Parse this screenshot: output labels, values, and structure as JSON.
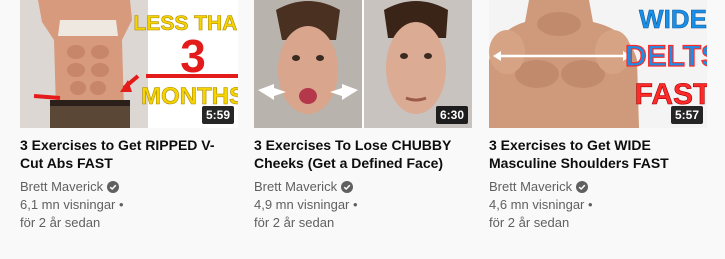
{
  "videos": [
    {
      "thumbnail_text": [
        "LESS THAN",
        "3",
        "MONTHS"
      ],
      "duration": "5:59",
      "title_lines": [
        "3 Exercises to Get RIPPED V-",
        "Cut Abs FAST"
      ],
      "channel": "Brett Maverick",
      "views": "6,1 mn visningar •",
      "age": "för 2 år sedan",
      "verified_icon": "verified-check-icon"
    },
    {
      "duration": "6:30",
      "title_lines": [
        "3 Exercises To Lose CHUBBY",
        "Cheeks (Get a Defined Face)"
      ],
      "channel": "Brett Maverick",
      "views": "4,9 mn visningar •",
      "age": "för 2 år sedan",
      "verified_icon": "verified-check-icon"
    },
    {
      "thumbnail_text": [
        "WIDE",
        "DELTS",
        "FAST"
      ],
      "duration": "5:57",
      "title_lines": [
        "3 Exercises to Get WIDE",
        "Masculine Shoulders FAST"
      ],
      "channel": "Brett Maverick",
      "views": "4,6 mn visningar •",
      "age": "för 2 år sedan",
      "verified_icon": "verified-check-icon"
    }
  ],
  "colors": {
    "thumb1_text": "#f5d400",
    "thumb1_red": "#e31b1b",
    "thumb3_text": "#1a8fe8",
    "thumb3_accent": "#ff2a2a"
  }
}
